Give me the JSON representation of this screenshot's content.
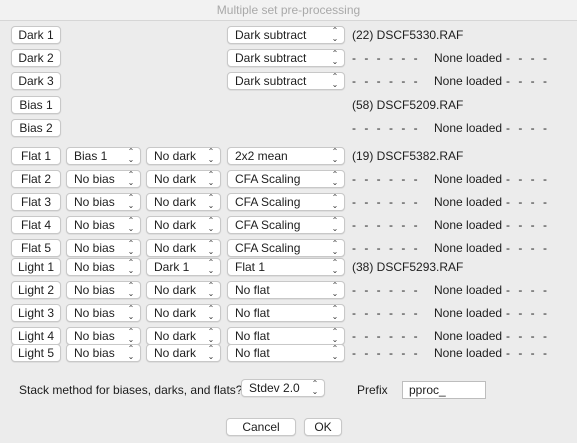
{
  "window": {
    "title": "Multiple set pre-processing"
  },
  "dark_rows": [
    {
      "button": "Dark 1",
      "method": "Dark subtract",
      "file": "(22) DSCF5330.RAF"
    },
    {
      "button": "Dark 2",
      "method": "Dark subtract",
      "file": "None loaded"
    },
    {
      "button": "Dark 3",
      "method": "Dark subtract",
      "file": "None loaded"
    }
  ],
  "bias_rows": [
    {
      "button": "Bias 1",
      "file": "(58) DSCF5209.RAF"
    },
    {
      "button": "Bias 2",
      "file": "None loaded"
    }
  ],
  "flat_rows": [
    {
      "button": "Flat 1",
      "bias": "Bias 1",
      "dark": "No dark",
      "method": "2x2 mean",
      "file": "(19) DSCF5382.RAF"
    },
    {
      "button": "Flat 2",
      "bias": "No bias",
      "dark": "No dark",
      "method": "CFA Scaling",
      "file": "None loaded"
    },
    {
      "button": "Flat 3",
      "bias": "No bias",
      "dark": "No dark",
      "method": "CFA Scaling",
      "file": "None loaded"
    },
    {
      "button": "Flat 4",
      "bias": "No bias",
      "dark": "No dark",
      "method": "CFA Scaling",
      "file": "None loaded"
    },
    {
      "button": "Flat 5",
      "bias": "No bias",
      "dark": "No dark",
      "method": "CFA Scaling",
      "file": "None loaded"
    }
  ],
  "light_rows": [
    {
      "button": "Light 1",
      "bias": "No bias",
      "dark": "Dark 1",
      "flat": "Flat 1",
      "file": "(38) DSCF5293.RAF"
    },
    {
      "button": "Light 2",
      "bias": "No bias",
      "dark": "No dark",
      "flat": "No flat",
      "file": "None loaded"
    },
    {
      "button": "Light 3",
      "bias": "No bias",
      "dark": "No dark",
      "flat": "No flat",
      "file": "None loaded"
    },
    {
      "button": "Light 4",
      "bias": "No bias",
      "dark": "No dark",
      "flat": "No flat",
      "file": "None loaded"
    },
    {
      "button": "Light 5",
      "bias": "No bias",
      "dark": "No dark",
      "flat": "No flat",
      "file": "None loaded"
    }
  ],
  "dash_text": "- - - - - -",
  "trail_dash_text": "- - - -",
  "stack": {
    "label": "Stack method for biases, darks, and flats?",
    "method": "Stdev 2.0",
    "prefix_label": "Prefix",
    "prefix_value": "pproc_"
  },
  "footer": {
    "cancel_label": "Cancel",
    "ok_label": "OK"
  }
}
